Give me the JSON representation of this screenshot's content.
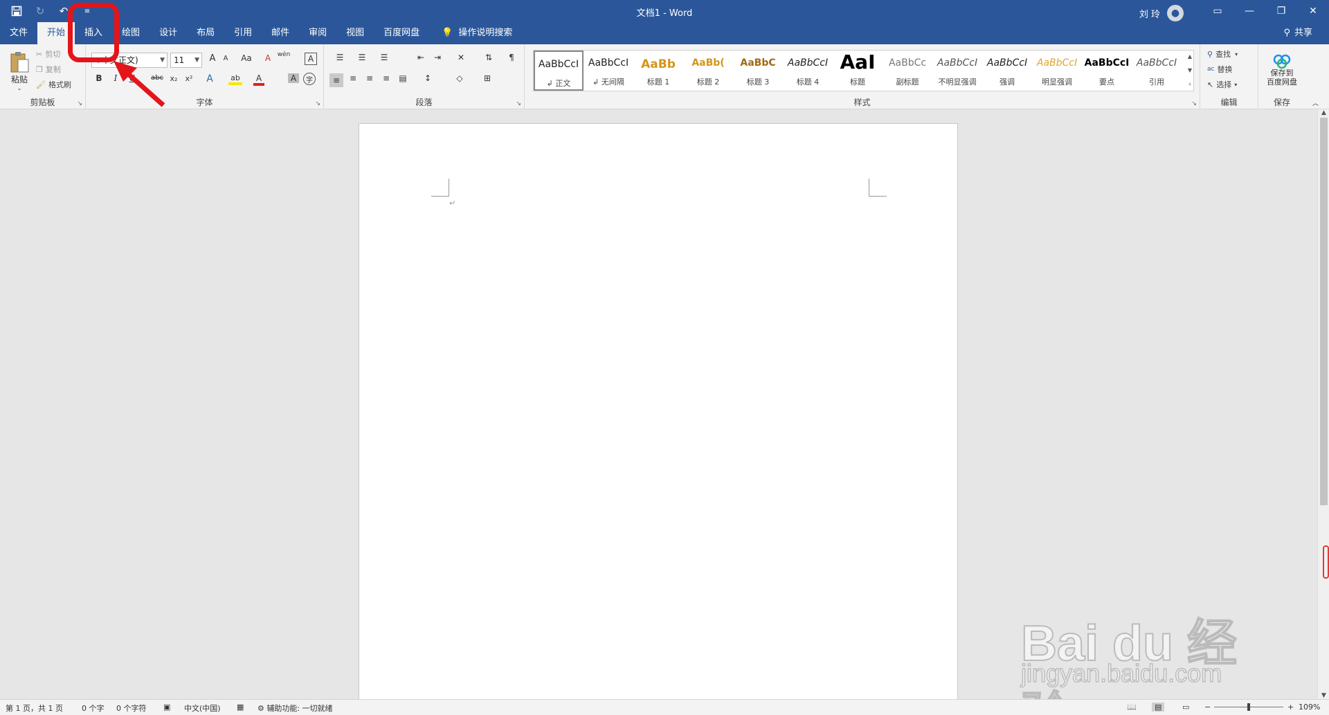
{
  "window": {
    "title": "文档1  -  Word",
    "user_name": "刘 玲",
    "controls": [
      "▭",
      "—",
      "❐",
      "✕"
    ]
  },
  "qat": {
    "save": "save-icon",
    "redo": "redo-icon",
    "undo": "undo-icon",
    "customize": "customize-qat-icon"
  },
  "tabs": [
    "文件",
    "开始",
    "插入",
    "绘图",
    "设计",
    "布局",
    "引用",
    "邮件",
    "审阅",
    "视图",
    "百度网盘"
  ],
  "active_tab": "开始",
  "tellme": "操作说明搜索",
  "share": "共享",
  "clipboard": {
    "paste": "粘贴",
    "cut": "剪切",
    "copy": "复制",
    "format_painter": "格式刷",
    "label": "剪贴板"
  },
  "font": {
    "font_name": "+中文正文)",
    "font_size": "11",
    "grow": "A",
    "shrink": "A",
    "case": "Aa",
    "clear": "A",
    "phonetic": "wén",
    "border": "A",
    "bold": "B",
    "italic": "I",
    "underline": "U",
    "strike": "abc",
    "sub": "x₂",
    "sup": "x²",
    "effects": "A",
    "highlight": "ab",
    "color": "A",
    "shade": "A",
    "encircle": "字",
    "label": "字体"
  },
  "paragraph": {
    "label": "段落"
  },
  "styles": {
    "label": "样式",
    "items": [
      {
        "preview": "AaBbCcI",
        "name": "↲ 正文",
        "color": "#222222"
      },
      {
        "preview": "AaBbCcI",
        "name": "↲ 无间隔",
        "color": "#222222"
      },
      {
        "preview": "AaBb",
        "name": "标题 1",
        "color": "#d4951a"
      },
      {
        "preview": "AaBb(",
        "name": "标题 2",
        "color": "#d4951a"
      },
      {
        "preview": "AaBbC",
        "name": "标题 3",
        "color": "#a06a13"
      },
      {
        "preview": "AaBbCcI",
        "name": "标题 4",
        "color": "#222222"
      },
      {
        "preview": "AaI",
        "name": "标题",
        "color": "#000000"
      },
      {
        "preview": "AaBbCc",
        "name": "副标题",
        "color": "#777777"
      },
      {
        "preview": "AaBbCcI",
        "name": "不明显强调",
        "color": "#555555"
      },
      {
        "preview": "AaBbCcI",
        "name": "强调",
        "color": "#222222"
      },
      {
        "preview": "AaBbCcI",
        "name": "明显强调",
        "color": "#e6a22a"
      },
      {
        "preview": "AaBbCcI",
        "name": "要点",
        "color": "#000000"
      },
      {
        "preview": "AaBbCcI",
        "name": "引用",
        "color": "#555555"
      }
    ]
  },
  "editing": {
    "find": "查找",
    "replace": "替换",
    "select": "选择",
    "label": "编辑"
  },
  "save_group": {
    "button": "保存到",
    "button2": "百度网盘",
    "label": "保存"
  },
  "document": {
    "para_mark": "↵"
  },
  "status": {
    "page": "第 1 页，共 1 页",
    "words": "0 个字",
    "chars": "0 个字符",
    "lang": "中文(中国)",
    "access": "辅助功能: 一切就绪",
    "zoom": "109%"
  },
  "watermark": {
    "brand": "Bai du 经验",
    "url": "jingyan.baidu.com"
  },
  "colors": {
    "accent": "#2b579a",
    "annotation": "#e4141b"
  }
}
